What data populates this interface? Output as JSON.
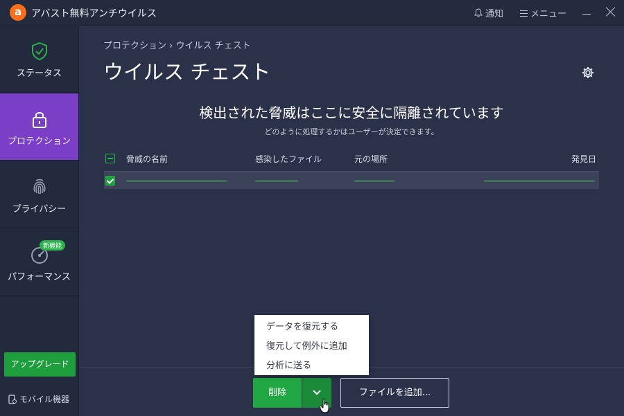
{
  "titlebar": {
    "logo_letter": "a",
    "app_title": "アバスト無料アンチウイルス",
    "notify_label": "通知",
    "menu_label": "メニュー"
  },
  "sidebar": {
    "items": [
      {
        "label": "ステータス",
        "icon": "shield-check-icon"
      },
      {
        "label": "プロテクション",
        "icon": "lock-icon",
        "active": true
      },
      {
        "label": "プライバシー",
        "icon": "fingerprint-icon"
      },
      {
        "label": "パフォーマンス",
        "icon": "speedometer-icon",
        "badge": "新機能"
      }
    ],
    "upgrade_label": "アップグレード",
    "mobile_label": "モバイル機器"
  },
  "main": {
    "breadcrumb": "プロテクション › ウイルス チェスト",
    "title": "ウイルス チェスト",
    "headline": "検出された脅威はここに安全に隔離されています",
    "subline": "どのように処理するかはユーザーが決定できます。",
    "table": {
      "columns": [
        "脅威の名前",
        "感染したファイル",
        "元の場所",
        "発見日"
      ]
    },
    "buttons": {
      "delete": "削除",
      "add_file": "ファイルを追加..."
    },
    "dropdown": {
      "items": [
        "データを復元する",
        "復元して例外に追加",
        "分析に送る"
      ]
    }
  },
  "colors": {
    "background": "#2b3148",
    "sidebar": "#232a3e",
    "active_nav": "#7b3fc7",
    "accent_green": "#22a745",
    "logo_orange": "#f96e1b"
  }
}
